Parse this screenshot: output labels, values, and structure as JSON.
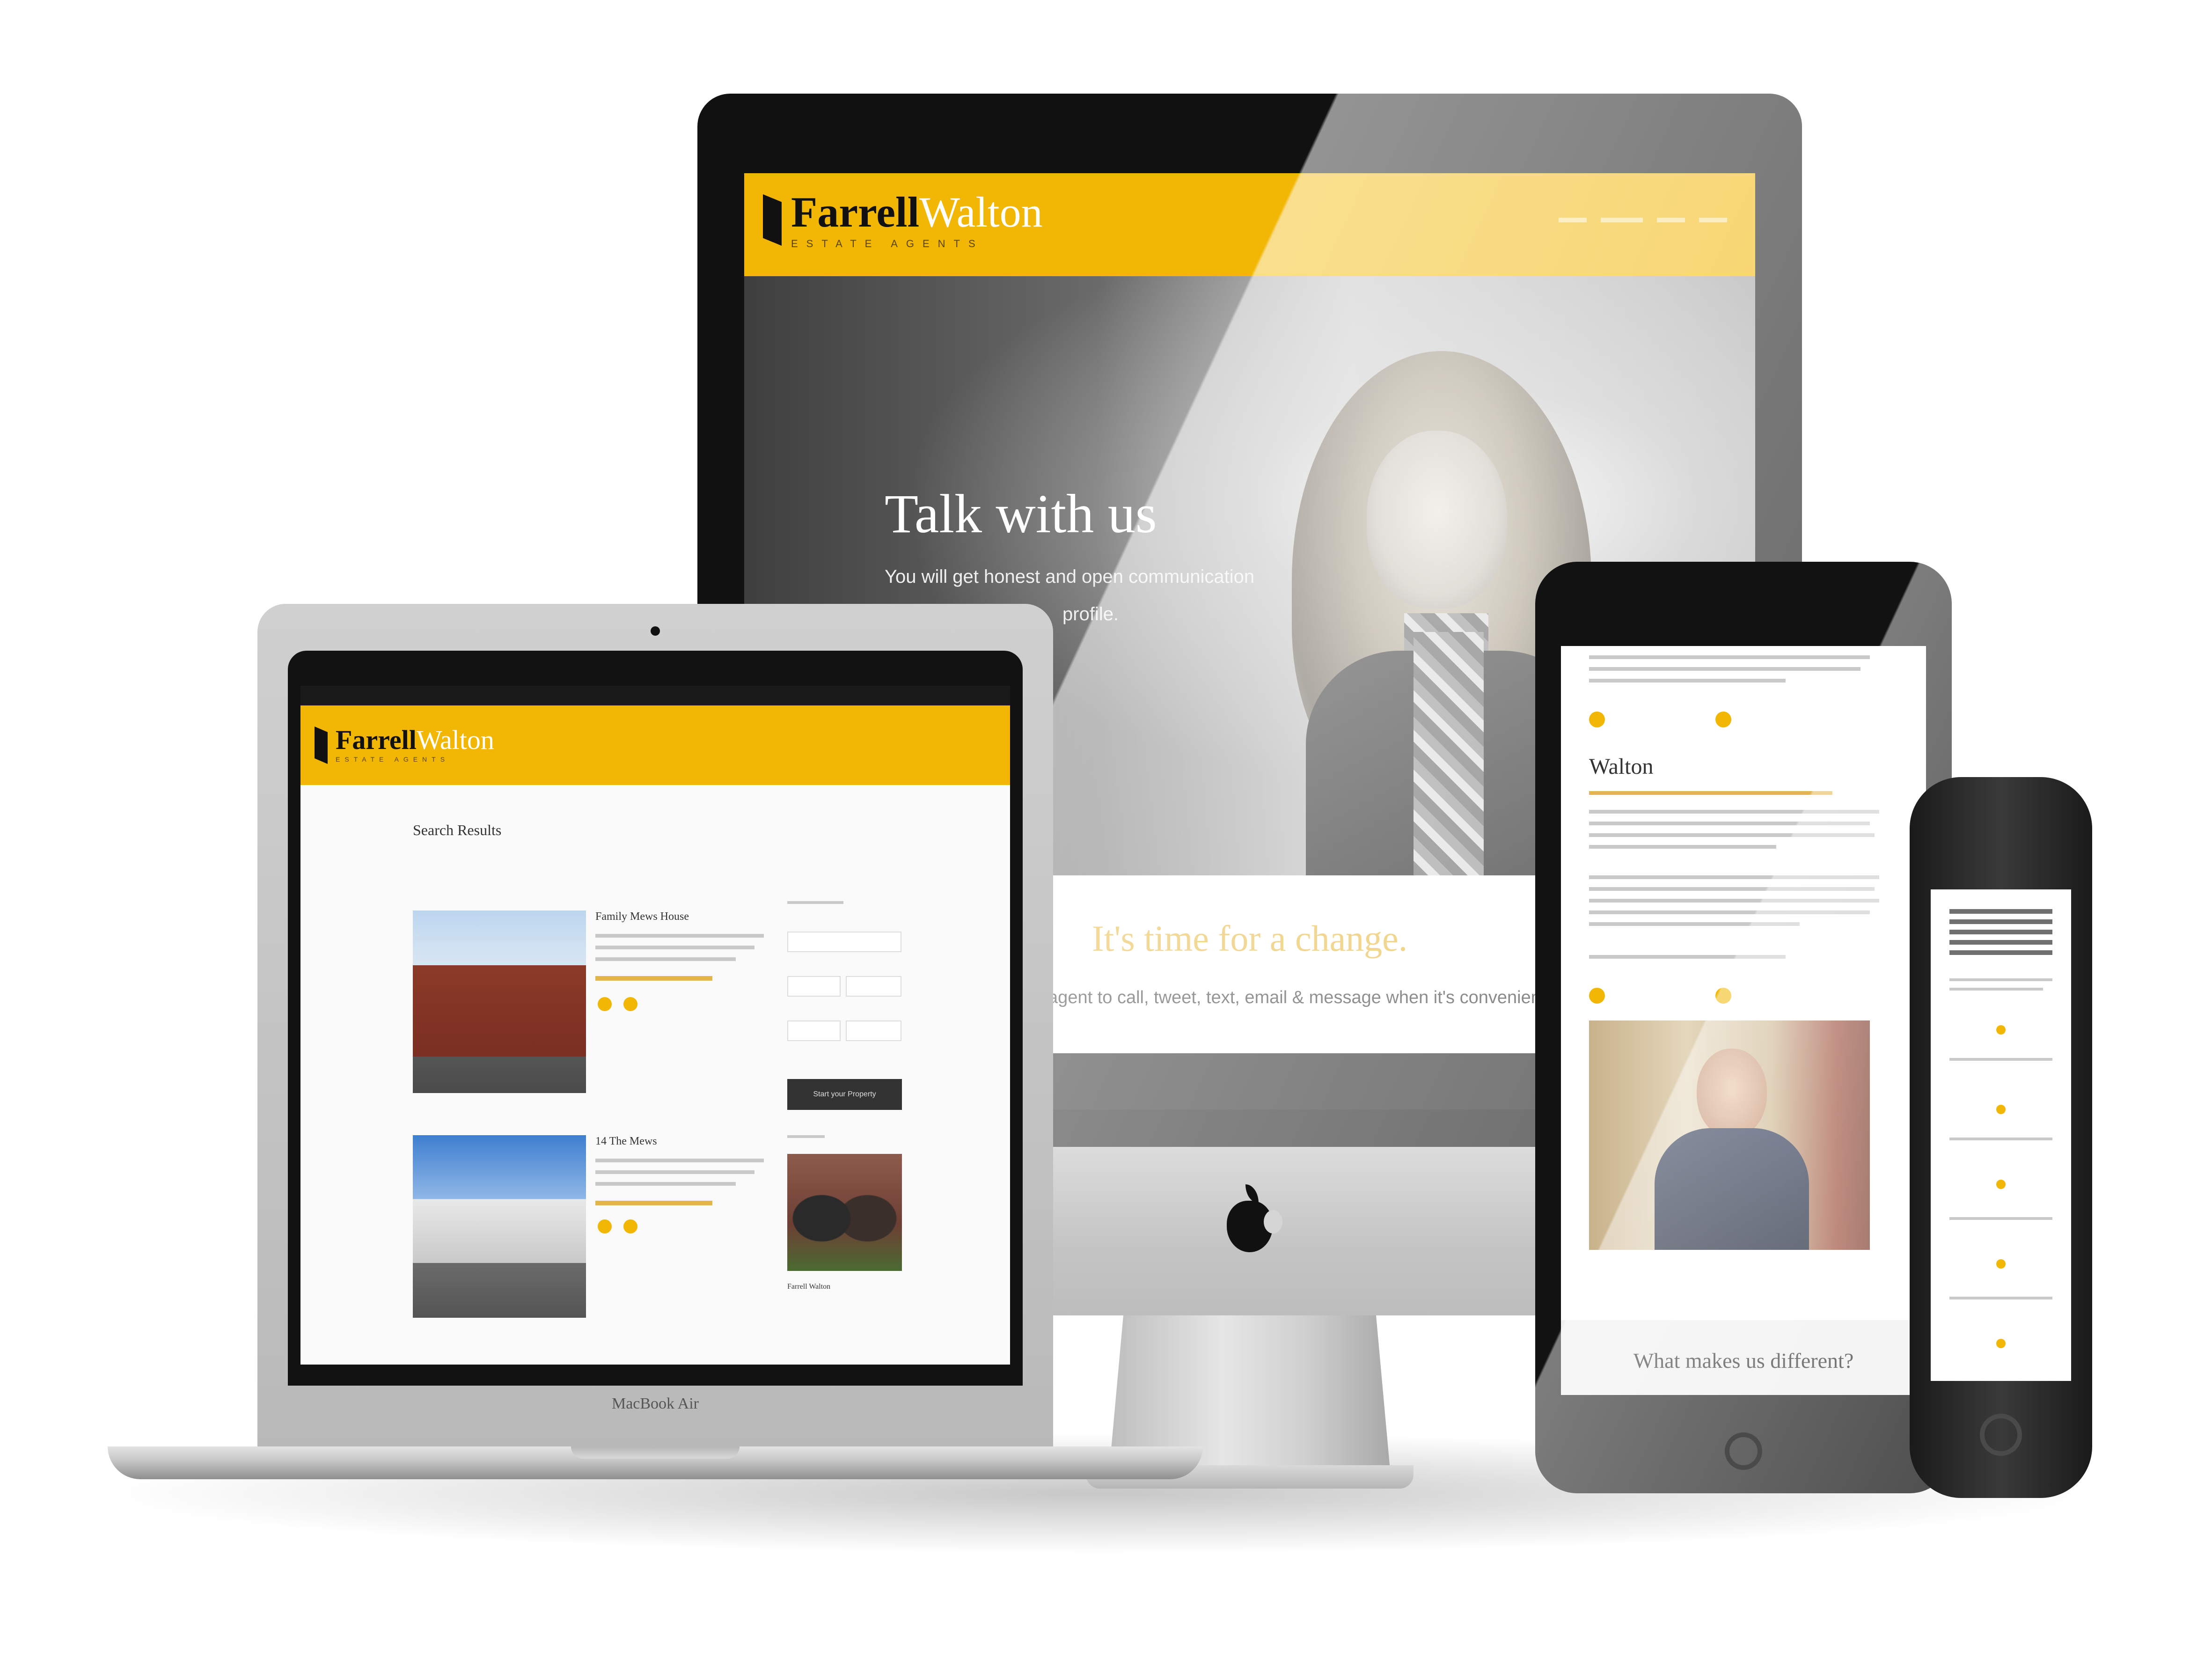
{
  "brand": {
    "name_part1": "Farrell",
    "name_part2": "Walton",
    "tagline": "ESTATE AGENTS",
    "accent_color": "#f2b705"
  },
  "imac": {
    "hero_title": "Talk with us",
    "hero_text_line1": "You will get honest and open communication",
    "hero_text_line2": "profile.",
    "change_heading": "It's time for a change.",
    "change_text": "...ence? An estate agent to call, tweet, text, email & message when it's convenient for y...",
    "logo_icon": "apple-logo-icon"
  },
  "macbook": {
    "page_title": "Search Results",
    "listing1_title": "Family Mews House",
    "listing2_title": "14 The Mews",
    "search_button": "Start your Property",
    "agent_name": "Farrell Walton",
    "model_label": "MacBook Air"
  },
  "ipad": {
    "agent_heading": "Walton",
    "section_heading": "What makes us different?"
  }
}
